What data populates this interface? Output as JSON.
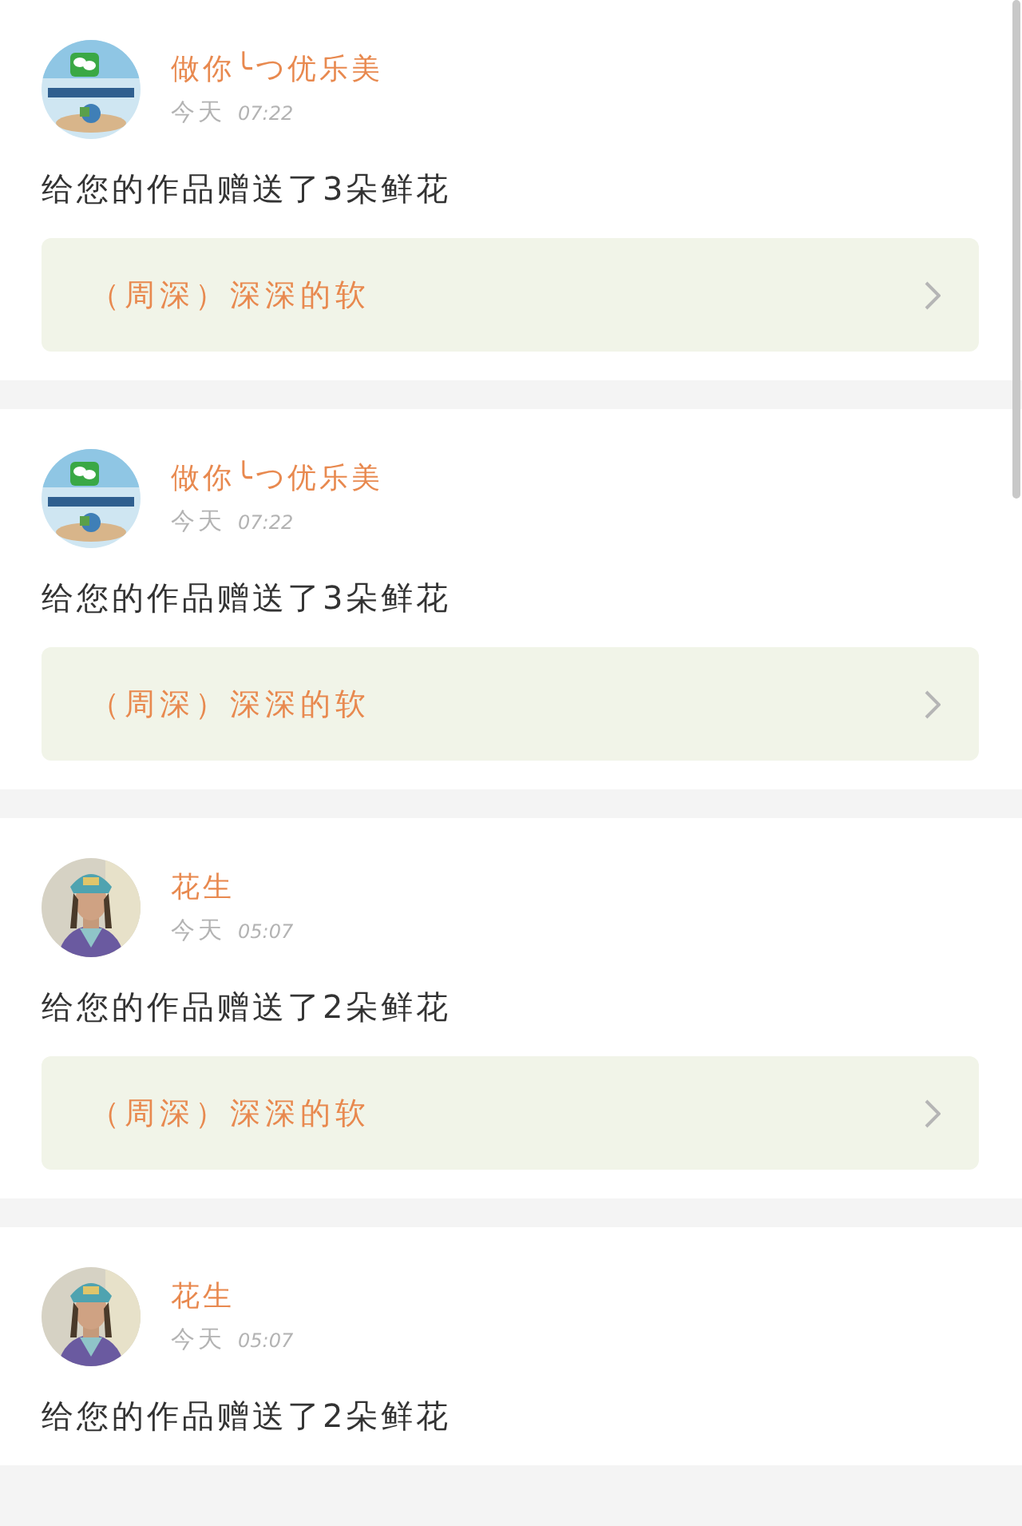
{
  "notifications": [
    {
      "user": "做你╰つ优乐美",
      "day": "今天",
      "time": "07:22",
      "message": "给您的作品赠送了3朵鲜花",
      "work": "（周深）深深的软"
    },
    {
      "user": "做你╰つ优乐美",
      "day": "今天",
      "time": "07:22",
      "message": "给您的作品赠送了3朵鲜花",
      "work": "（周深）深深的软"
    },
    {
      "user": "花生",
      "day": "今天",
      "time": "05:07",
      "message": "给您的作品赠送了2朵鲜花",
      "work": "（周深）深深的软"
    },
    {
      "user": "花生",
      "day": "今天",
      "time": "05:07",
      "message": "给您的作品赠送了2朵鲜花"
    }
  ]
}
